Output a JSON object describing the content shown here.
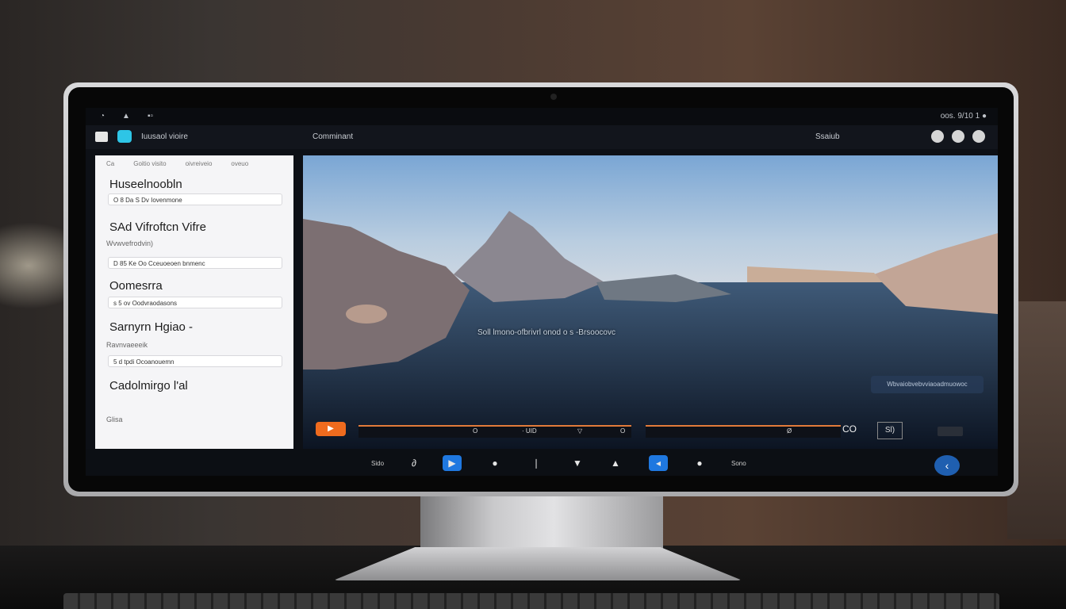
{
  "menubar": {
    "left_items": [
      "",
      "",
      "🔋"
    ],
    "right_status": "oos. 9/10 1 ●"
  },
  "toolbar": {
    "title": "Iuusaol vioire",
    "center_title": "Comminant",
    "user": "Ssaiub"
  },
  "sidebar": {
    "filters": [
      "Ca",
      "Goitio visito",
      "oivreiveio",
      "oveuo"
    ],
    "sections": [
      {
        "heading": "Huseelnoobln",
        "caption": "",
        "field": "O 8 Da S Dv Iovenmone"
      },
      {
        "heading": "SAd Vifroftcn Vifre",
        "caption": "Wvwvefrodvin)",
        "field": "D 85 Ke Oo Cceuoeoen bnmenc"
      },
      {
        "heading": "Oomesrra",
        "caption": "",
        "field": "s 5 ov Oodvraodasons"
      },
      {
        "heading": "Sarnyrn Hgiao -",
        "caption": "Ravnvaeeeik",
        "field": "5 d tpdi Ocoanouemn"
      },
      {
        "heading": "Cadolmirgo l'al",
        "caption": "Glisa",
        "field": ""
      }
    ]
  },
  "viewer": {
    "overlay": "Soll lmono-ofbrivrl onod o s -Brsoocovc",
    "info_pill": "Wbvaiobvebvviaoadmuowoc",
    "play_label": "▶",
    "time_start": "O",
    "time_mid": "· UID",
    "time_marker": "▽",
    "time_end": "O",
    "time_marker2": "Ø",
    "co_label": "CO",
    "end_label": "Sl)"
  },
  "dock": {
    "left_label": "Sido",
    "right_label": "Sono"
  },
  "colors": {
    "accent": "#ef6b1e",
    "blue": "#1f78e0",
    "cyan": "#2ec5e6"
  }
}
